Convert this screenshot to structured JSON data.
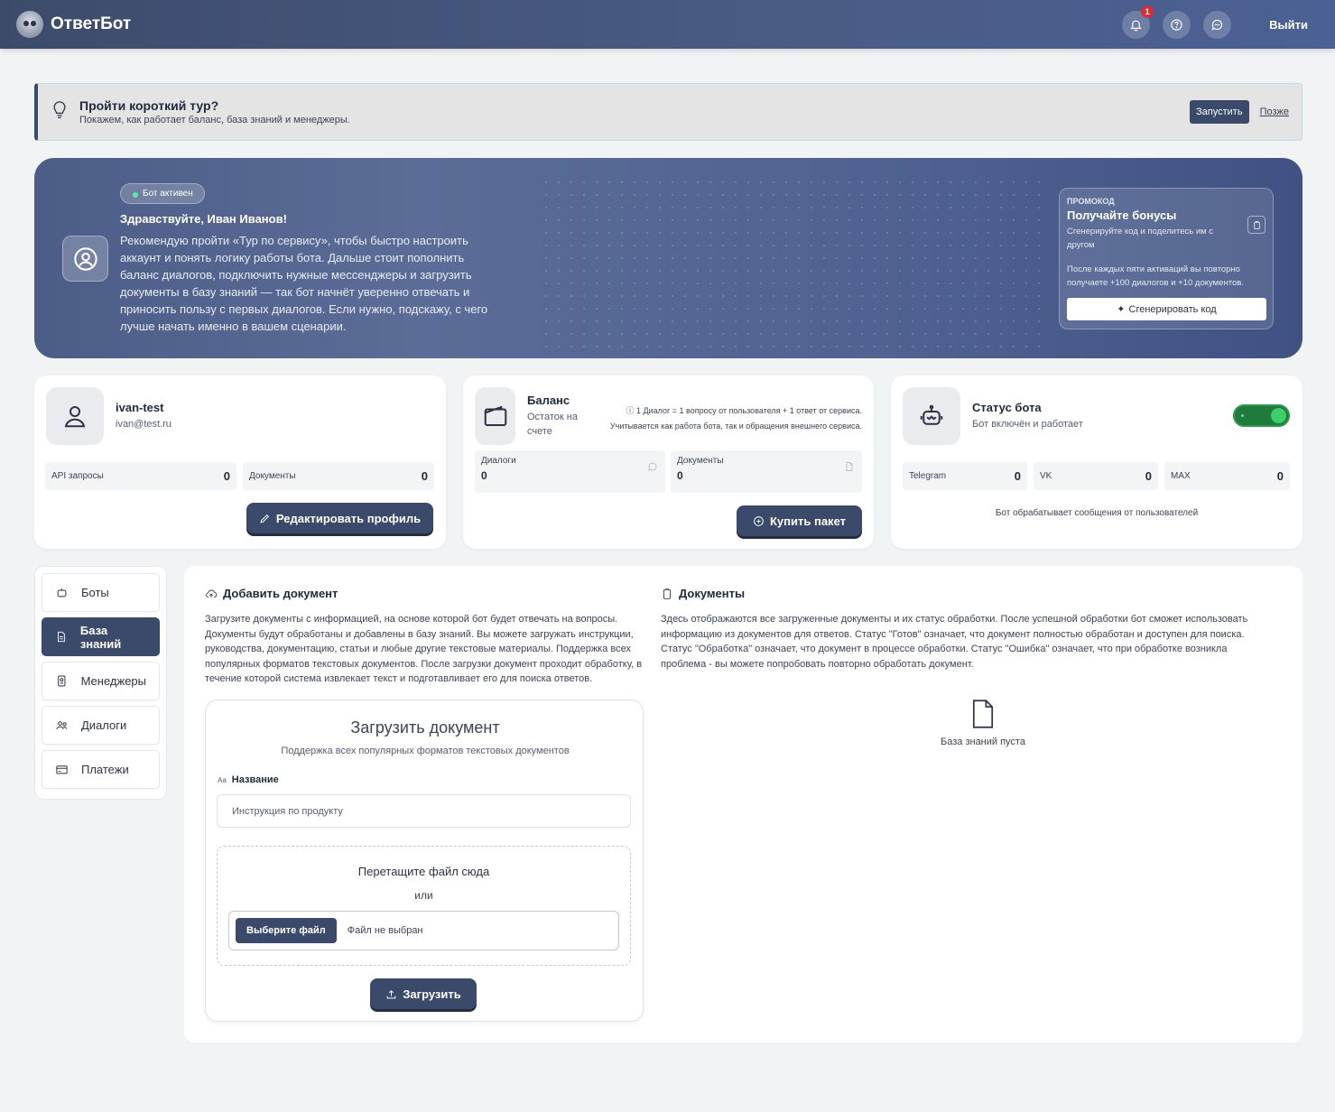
{
  "header": {
    "app_name": "ОтветБот",
    "notifications_count": "1",
    "logout_label": "Выйти"
  },
  "tour": {
    "title": "Пройти короткий тур?",
    "subtitle": "Покажем, как работает баланс, база знаний и менеджеры.",
    "start_label": "Запустить",
    "later_label": "Позже"
  },
  "hero": {
    "status": "Бот активен",
    "greeting": "Здравствуйте, Иван Иванов!",
    "message": "Рекомендую пройти «Тур по сервису», чтобы быстро настроить аккаунт и понять логику работы бота. Дальше стоит пополнить баланс диалогов, подключить нужные мессенджеры и загрузить документы в базу знаний — так бот начнёт уверенно отвечать и приносить пользу с первых диалогов. Если нужно, подскажу, с чего лучше начать именно в вашем сценарии.",
    "promo": {
      "label": "ПРОМОКОД",
      "title": "Получайте бонусы",
      "subtitle": "Сгенерируйте код и поделитесь им с другом",
      "description": "После каждых пяти активаций вы повторно получаете +100 диалогов и +10 документов.",
      "button_label": "Сгенерировать код"
    }
  },
  "profile": {
    "username": "ivan-test",
    "email": "ivan@test.ru",
    "stats": [
      {
        "label": "API запросы",
        "value": "0"
      },
      {
        "label": "Документы",
        "value": "0"
      }
    ],
    "edit_label": "Редактировать профиль"
  },
  "balance": {
    "title": "Баланс",
    "subtitle": "Остаток на счете",
    "note1": "ⓘ 1 Диалог = 1 вопросу от пользователя + 1 ответ от сервиса.",
    "note2": "Учитывается как работа бота, так и обращения внешнего сервиса.",
    "dialogs_label": "Диалоги",
    "dialogs_value": "0",
    "documents_label": "Документы",
    "documents_value": "0",
    "buy_label": "Купить пакет"
  },
  "bot_status": {
    "title": "Статус бота",
    "subtitle": "Бот включён и работает",
    "enabled": true,
    "channels": [
      {
        "label": "Telegram",
        "value": "0"
      },
      {
        "label": "VK",
        "value": "0"
      },
      {
        "label": "MAX",
        "value": "0"
      }
    ],
    "note": "Бот обрабатывает сообщения от пользователей"
  },
  "sidebar": {
    "items": [
      {
        "label": "Боты",
        "icon": "robot-icon",
        "active": false
      },
      {
        "label": "База знаний",
        "icon": "document-icon",
        "active": true
      },
      {
        "label": "Менеджеры",
        "icon": "badge-icon",
        "active": false
      },
      {
        "label": "Диалоги",
        "icon": "users-icon",
        "active": false
      },
      {
        "label": "Платежи",
        "icon": "card-icon",
        "active": false
      }
    ]
  },
  "add_document": {
    "title": "Добавить документ",
    "description": "Загрузите документы с информацией, на основе которой бот будет отвечать на вопросы. Документы будут обработаны и добавлены в базу знаний. Вы можете загружать инструкции, руководства, документацию, статьи и любые другие текстовые материалы. Поддержка всех популярных форматов текстовых документов. После загрузки документ проходит обработку, в течение которой система извлекает текст и подготавливает его для поиска ответов.",
    "upload_title": "Загрузить документ",
    "upload_subtitle": "Поддержка всех популярных форматов текстовых документов",
    "name_label_prefix": "Aa",
    "name_label": "Название",
    "name_placeholder": "Инструкция по продукту",
    "drop_text": "Перетащите файл сюда",
    "or_text": "или",
    "choose_file_label": "Выберите файл",
    "no_file_text": "Файл не выбран",
    "upload_button": "Загрузить"
  },
  "documents": {
    "title": "Документы",
    "description": "Здесь отображаются все загруженные документы и их статус обработки. После успешной обработки бот сможет использовать информацию из документов для ответов. Статус \"Готов\" означает, что документ полностью обработан и доступен для поиска. Статус \"Обработка\" означает, что документ в процессе обработки. Статус \"Ошибка\" означает, что при обработке возникла проблема - вы можете попробовать повторно обработать документ.",
    "empty_text": "База знаний пуста"
  },
  "colors": {
    "primary": "#3b4a6b",
    "header": "#4a5c85",
    "status_on": "#3ecf6d",
    "badge": "#d62f3a"
  }
}
